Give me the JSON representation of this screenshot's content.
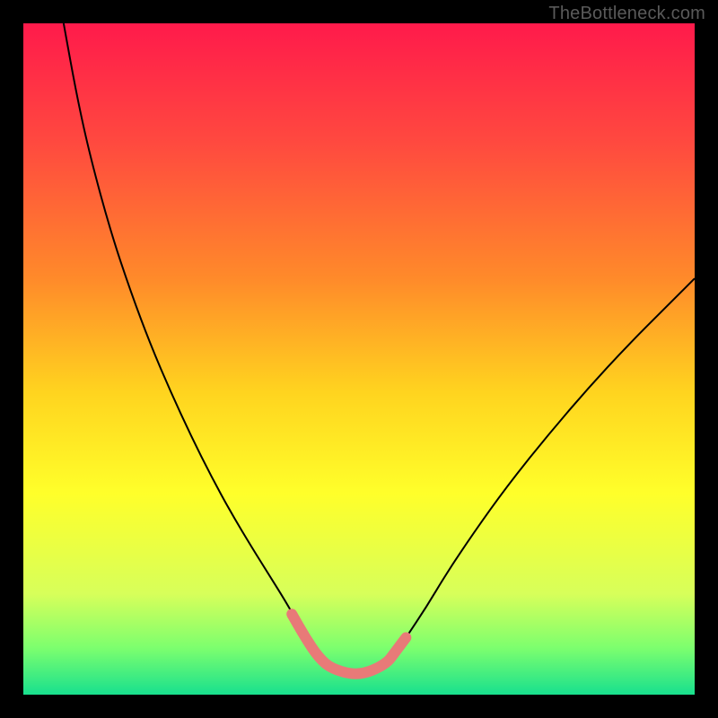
{
  "watermark": "TheBottleneck.com",
  "chart_data": {
    "type": "line",
    "title": "",
    "xlabel": "",
    "ylabel": "",
    "xlim": [
      0,
      100
    ],
    "ylim": [
      0,
      100
    ],
    "gradient_stops": [
      {
        "offset": 0,
        "color": "#ff1a4b"
      },
      {
        "offset": 18,
        "color": "#ff4a3f"
      },
      {
        "offset": 38,
        "color": "#ff8a2a"
      },
      {
        "offset": 55,
        "color": "#ffd41f"
      },
      {
        "offset": 70,
        "color": "#ffff2a"
      },
      {
        "offset": 85,
        "color": "#d7ff5a"
      },
      {
        "offset": 93,
        "color": "#7dff6e"
      },
      {
        "offset": 100,
        "color": "#18e08e"
      }
    ],
    "series": [
      {
        "name": "curve",
        "color": "#000000",
        "stroke_width": 2,
        "x": [
          6,
          8,
          10,
          13,
          16,
          19,
          22,
          25,
          28,
          31,
          34,
          36.5,
          39,
          41,
          43,
          45,
          50,
          55,
          57,
          60,
          63,
          67,
          72,
          78,
          84,
          90,
          96,
          100
        ],
        "y": [
          100,
          89,
          80,
          69,
          60,
          52,
          45,
          38.5,
          32.5,
          27,
          22,
          18,
          14,
          10.5,
          7.5,
          5,
          2.8,
          5.5,
          8.5,
          13,
          18,
          24,
          31,
          38.5,
          45.5,
          52,
          58,
          62
        ]
      },
      {
        "name": "highlight",
        "color": "#e87a78",
        "stroke_width": 12,
        "linecap": "round",
        "x": [
          40,
          42,
          44,
          46,
          50,
          54,
          55.5,
          57
        ],
        "y": [
          12,
          8.5,
          5.5,
          3.8,
          2.8,
          4.5,
          6.5,
          8.5
        ]
      }
    ]
  }
}
